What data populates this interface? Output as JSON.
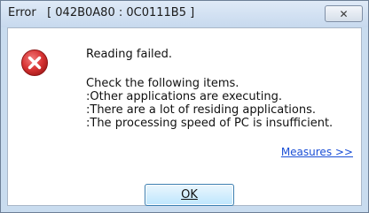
{
  "window": {
    "title": "Error   [ 042B0A80 : 0C0111B5 ]",
    "close_label": "✕"
  },
  "message": {
    "headline": "Reading failed.",
    "details": [
      "Check the following items.",
      ":Other applications are executing.",
      ":There are a lot of residing applications.",
      ":The processing speed of PC is insufficient."
    ]
  },
  "link": {
    "measures_label": "Measures >>"
  },
  "buttons": {
    "ok_label": "OK"
  },
  "colors": {
    "error_icon": "#d63232",
    "link": "#1b4fd6"
  },
  "icons": {
    "error": "error-x-icon",
    "close": "close-icon"
  }
}
